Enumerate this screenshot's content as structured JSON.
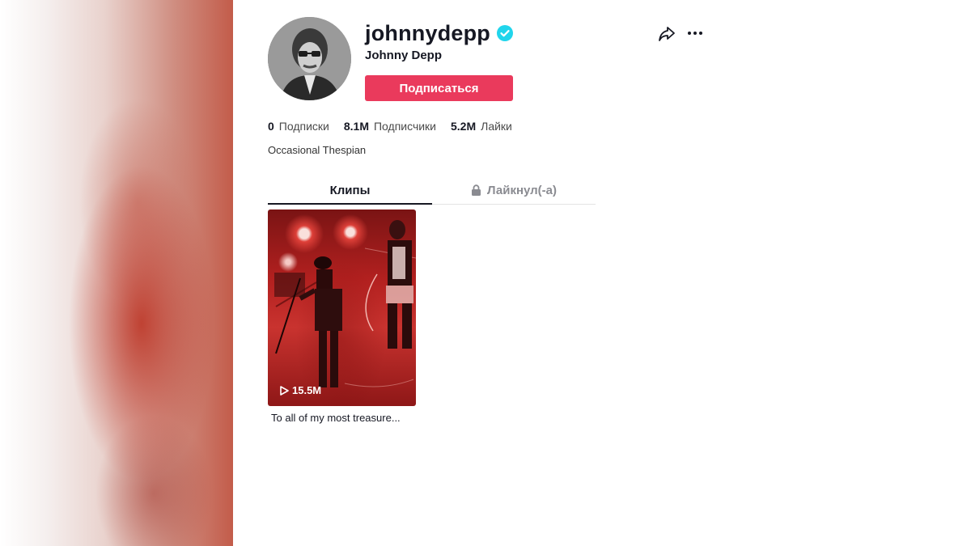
{
  "profile": {
    "username": "johnnydepp",
    "display_name": "Johnny Depp",
    "follow_label": "Подписаться",
    "bio": "Occasional Thespian",
    "accent_color": "#ea3a5c",
    "verified_color": "#20d5ec"
  },
  "stats": [
    {
      "value": "0",
      "label": "Подписки"
    },
    {
      "value": "8.1M",
      "label": "Подписчики"
    },
    {
      "value": "5.2M",
      "label": "Лайки"
    }
  ],
  "tabs": [
    {
      "label": "Клипы",
      "active": true
    },
    {
      "label": "Лайкнул(-а)",
      "active": false,
      "icon": "lock-icon"
    }
  ],
  "videos": [
    {
      "views": "15.5M",
      "caption": "To all of my most treasure..."
    }
  ],
  "icons": {
    "share": "share-icon",
    "more": "more-icon",
    "verified": "verified-icon",
    "play": "play-icon"
  }
}
